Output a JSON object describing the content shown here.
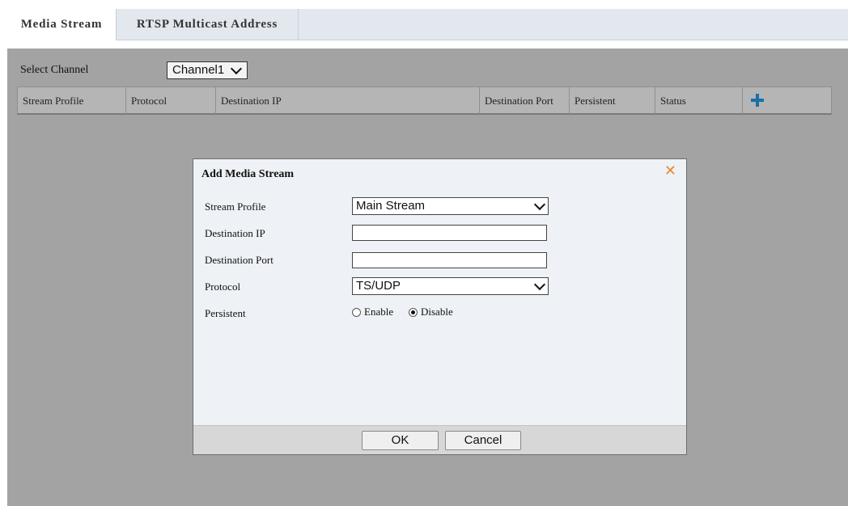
{
  "tabs": [
    {
      "label": "Media Stream",
      "active": true
    },
    {
      "label": "RTSP Multicast Address",
      "active": false
    }
  ],
  "channel": {
    "label": "Select Channel",
    "value": "Channel1"
  },
  "table": {
    "headers": [
      "Stream Profile",
      "Protocol",
      "Destination IP",
      "Destination Port",
      "Persistent",
      "Status"
    ],
    "add_icon": "plus-icon",
    "rows": []
  },
  "dialog": {
    "title": "Add Media Stream",
    "close_icon": "close-icon",
    "fields": {
      "stream_profile": {
        "label": "Stream Profile",
        "value": "Main Stream"
      },
      "destination_ip": {
        "label": "Destination IP",
        "value": ""
      },
      "destination_port": {
        "label": "Destination Port",
        "value": ""
      },
      "protocol": {
        "label": "Protocol",
        "value": "TS/UDP"
      },
      "persistent": {
        "label": "Persistent",
        "options": [
          "Enable",
          "Disable"
        ],
        "selected": "Disable"
      }
    },
    "ok_label": "OK",
    "cancel_label": "Cancel"
  },
  "colors": {
    "overlay": "#a3a3a3",
    "dialog_bg": "#eef1f5",
    "accent_plus": "#1b6fa9",
    "close_x": "#e58b2a"
  }
}
